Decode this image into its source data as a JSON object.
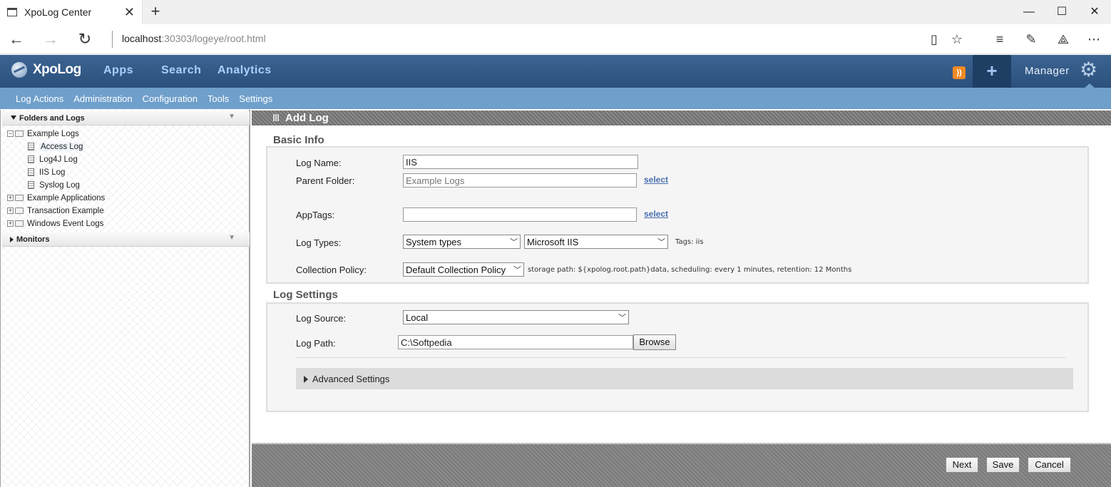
{
  "browser": {
    "tab_title": "XpoLog Center",
    "tab_close": "✕",
    "new_tab": "+",
    "address_host": "localhost",
    "address_rest": ":30303/logeye/root.html",
    "window_controls": {
      "minimize": "—",
      "maximize": "☐",
      "close": "✕"
    },
    "icons": [
      "back-arrow-icon",
      "forward-arrow-icon",
      "refresh-icon",
      "reading-view-icon",
      "favorite-star-icon",
      "hub-icon",
      "web-note-icon",
      "share-icon",
      "more-icon"
    ]
  },
  "app": {
    "logo": "XpoLog",
    "main_nav": [
      "Apps",
      "Search",
      "Analytics"
    ],
    "rss_label": "RSS",
    "plus": "+",
    "manager": "Manager",
    "sub_nav": [
      "Log Actions",
      "Administration",
      "Configuration",
      "Tools",
      "Settings"
    ]
  },
  "sidebar": {
    "folders_title": "Folders and Logs",
    "monitors_title": "Monitors",
    "tree": [
      {
        "label": "Example Logs",
        "type": "folder",
        "expanded": true
      },
      {
        "label": "Access Log",
        "type": "log",
        "selected": true
      },
      {
        "label": "Log4J Log",
        "type": "log"
      },
      {
        "label": "IIS Log",
        "type": "log"
      },
      {
        "label": "Syslog Log",
        "type": "log"
      },
      {
        "label": "Example Applications",
        "type": "folder"
      },
      {
        "label": "Transaction Example",
        "type": "folder"
      },
      {
        "label": "Windows Event Logs",
        "type": "folder"
      }
    ]
  },
  "form": {
    "header": "Add Log",
    "basic_info": "Basic Info",
    "log_name_label": "Log Name:",
    "log_name_value": "IIS",
    "parent_folder_label": "Parent Folder:",
    "parent_folder_placeholder": "Example Logs",
    "select_link": "select",
    "apptags_label": "AppTags:",
    "apptags_value": "",
    "log_types_label": "Log Types:",
    "log_types_category": "System types",
    "log_types_type": "Microsoft IIS",
    "tags_text": "Tags: iis",
    "collection_policy_label": "Collection Policy:",
    "collection_policy_value": "Default Collection Policy",
    "collection_policy_info": "storage path: ${xpolog.root.path}data, scheduling: every 1 minutes, retention: 12 Months",
    "log_settings": "Log Settings",
    "log_source_label": "Log Source:",
    "log_source_value": "Local",
    "log_path_label": "Log Path:",
    "log_path_value": "C:\\Softpedia",
    "browse_button": "Browse",
    "advanced_settings": "Advanced Settings",
    "next_button": "Next",
    "save_button": "Save",
    "cancel_button": "Cancel"
  },
  "colors": {
    "header_blue": "#2b507c",
    "subnav_blue": "#6f9fcb",
    "nav_link": "#a7d2ff",
    "rss_orange": "#f08a24"
  }
}
